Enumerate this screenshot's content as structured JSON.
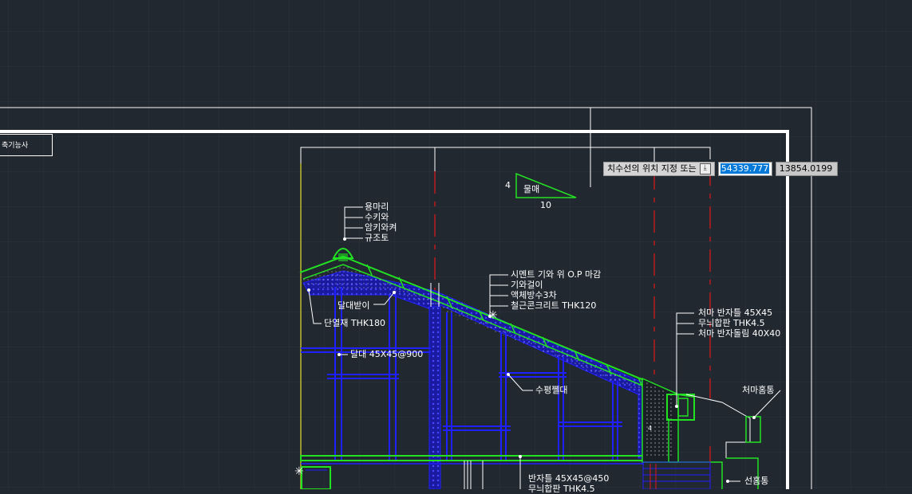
{
  "titleblock": {
    "text": "축기능사"
  },
  "slope": {
    "rise": "4",
    "run": "10",
    "label": "물매"
  },
  "dynamic_input": {
    "prompt": "치수선의 위치 지정 또는",
    "icon": "download-arrow-icon",
    "value1": "54339.777",
    "value2": "13854.0199"
  },
  "annotations": {
    "ridge": [
      "용마리",
      "수키와",
      "암키와켜",
      "규조토"
    ],
    "roof": [
      "시멘트 기와 위 O.P 마감",
      "기와걸이",
      "액체방수3차",
      "철근콘크리트 THK120"
    ],
    "eave": [
      "처마 반자틀 45X45",
      "무늬합판 THK4.5",
      "처마 반자돌림 40X40"
    ],
    "rafter_hanger": "달대받이",
    "insulation": "단열재 THK180",
    "hanger": "달대 45X45@900",
    "horizontal_member": "수평쪨대",
    "gutter": "처마홈통",
    "downspout": "선홈통",
    "ceiling": [
      "반자틀 45X45@450",
      "무늬합판 THK4.5"
    ],
    "hatch_mark": "4"
  },
  "colors": {
    "background": "#212830",
    "grid": "#2c3440",
    "green": "#22e022",
    "blue": "#2020ff",
    "red": "#e01818",
    "yellow": "#e0e030",
    "white": "#ffffff"
  }
}
